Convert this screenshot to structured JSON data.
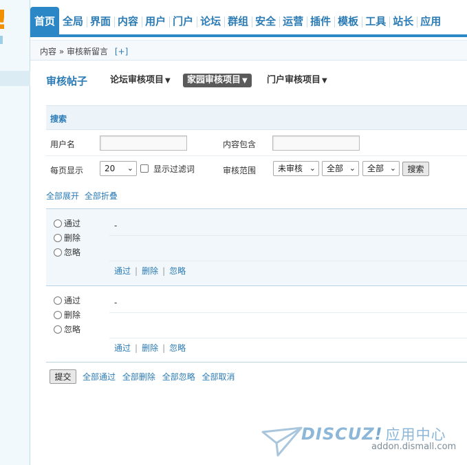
{
  "nav": {
    "items": [
      "首页",
      "全局",
      "界面",
      "内容",
      "用户",
      "门户",
      "论坛",
      "群组",
      "安全",
      "运营",
      "插件",
      "模板",
      "工具",
      "站长",
      "应用"
    ],
    "active_index": 0
  },
  "breadcrumb": {
    "section": "内容",
    "separator": "»",
    "page": "审核新留言",
    "add": "[+]"
  },
  "header": {
    "title": "审核帖子",
    "tabs": [
      {
        "label": "论坛审核项目",
        "caret": "▼",
        "active": false
      },
      {
        "label": "家园审核项目",
        "caret": "▼",
        "active": true
      },
      {
        "label": "门户审核项目",
        "caret": "▼",
        "active": false
      }
    ]
  },
  "search": {
    "heading": "搜索",
    "username_label": "用户名",
    "username_value": "",
    "content_label": "内容包含",
    "content_value": "",
    "perpage_label": "每页显示",
    "perpage_value": "20",
    "filter_label": "显示过滤词",
    "filter_checked": false,
    "scope_label": "审核范围",
    "scope_status": "未审核",
    "scope_type": "全部",
    "scope_time": "全部",
    "search_button": "搜索"
  },
  "toggles": {
    "expand_all": "全部展开",
    "collapse_all": "全部折叠"
  },
  "posts": [
    {
      "options": [
        "通过",
        "删除",
        "忽略"
      ],
      "content": "-",
      "actions": [
        "通过",
        "删除",
        "忽略"
      ],
      "action_sep": "|"
    },
    {
      "options": [
        "通过",
        "删除",
        "忽略"
      ],
      "content": "-",
      "actions": [
        "通过",
        "删除",
        "忽略"
      ],
      "action_sep": "|"
    }
  ],
  "footer": {
    "submit": "提交",
    "bulk": [
      "全部通过",
      "全部删除",
      "全部忽略",
      "全部取消"
    ]
  },
  "watermark": {
    "brand": "DISCUZ",
    "mark": "!",
    "cn": "应用中心",
    "url": "addon.dismall.com"
  },
  "logo": {
    "mark": "!"
  },
  "colors": {
    "accent": "#2b87c6",
    "link": "#2b7bb5",
    "logo": "#f29100"
  }
}
